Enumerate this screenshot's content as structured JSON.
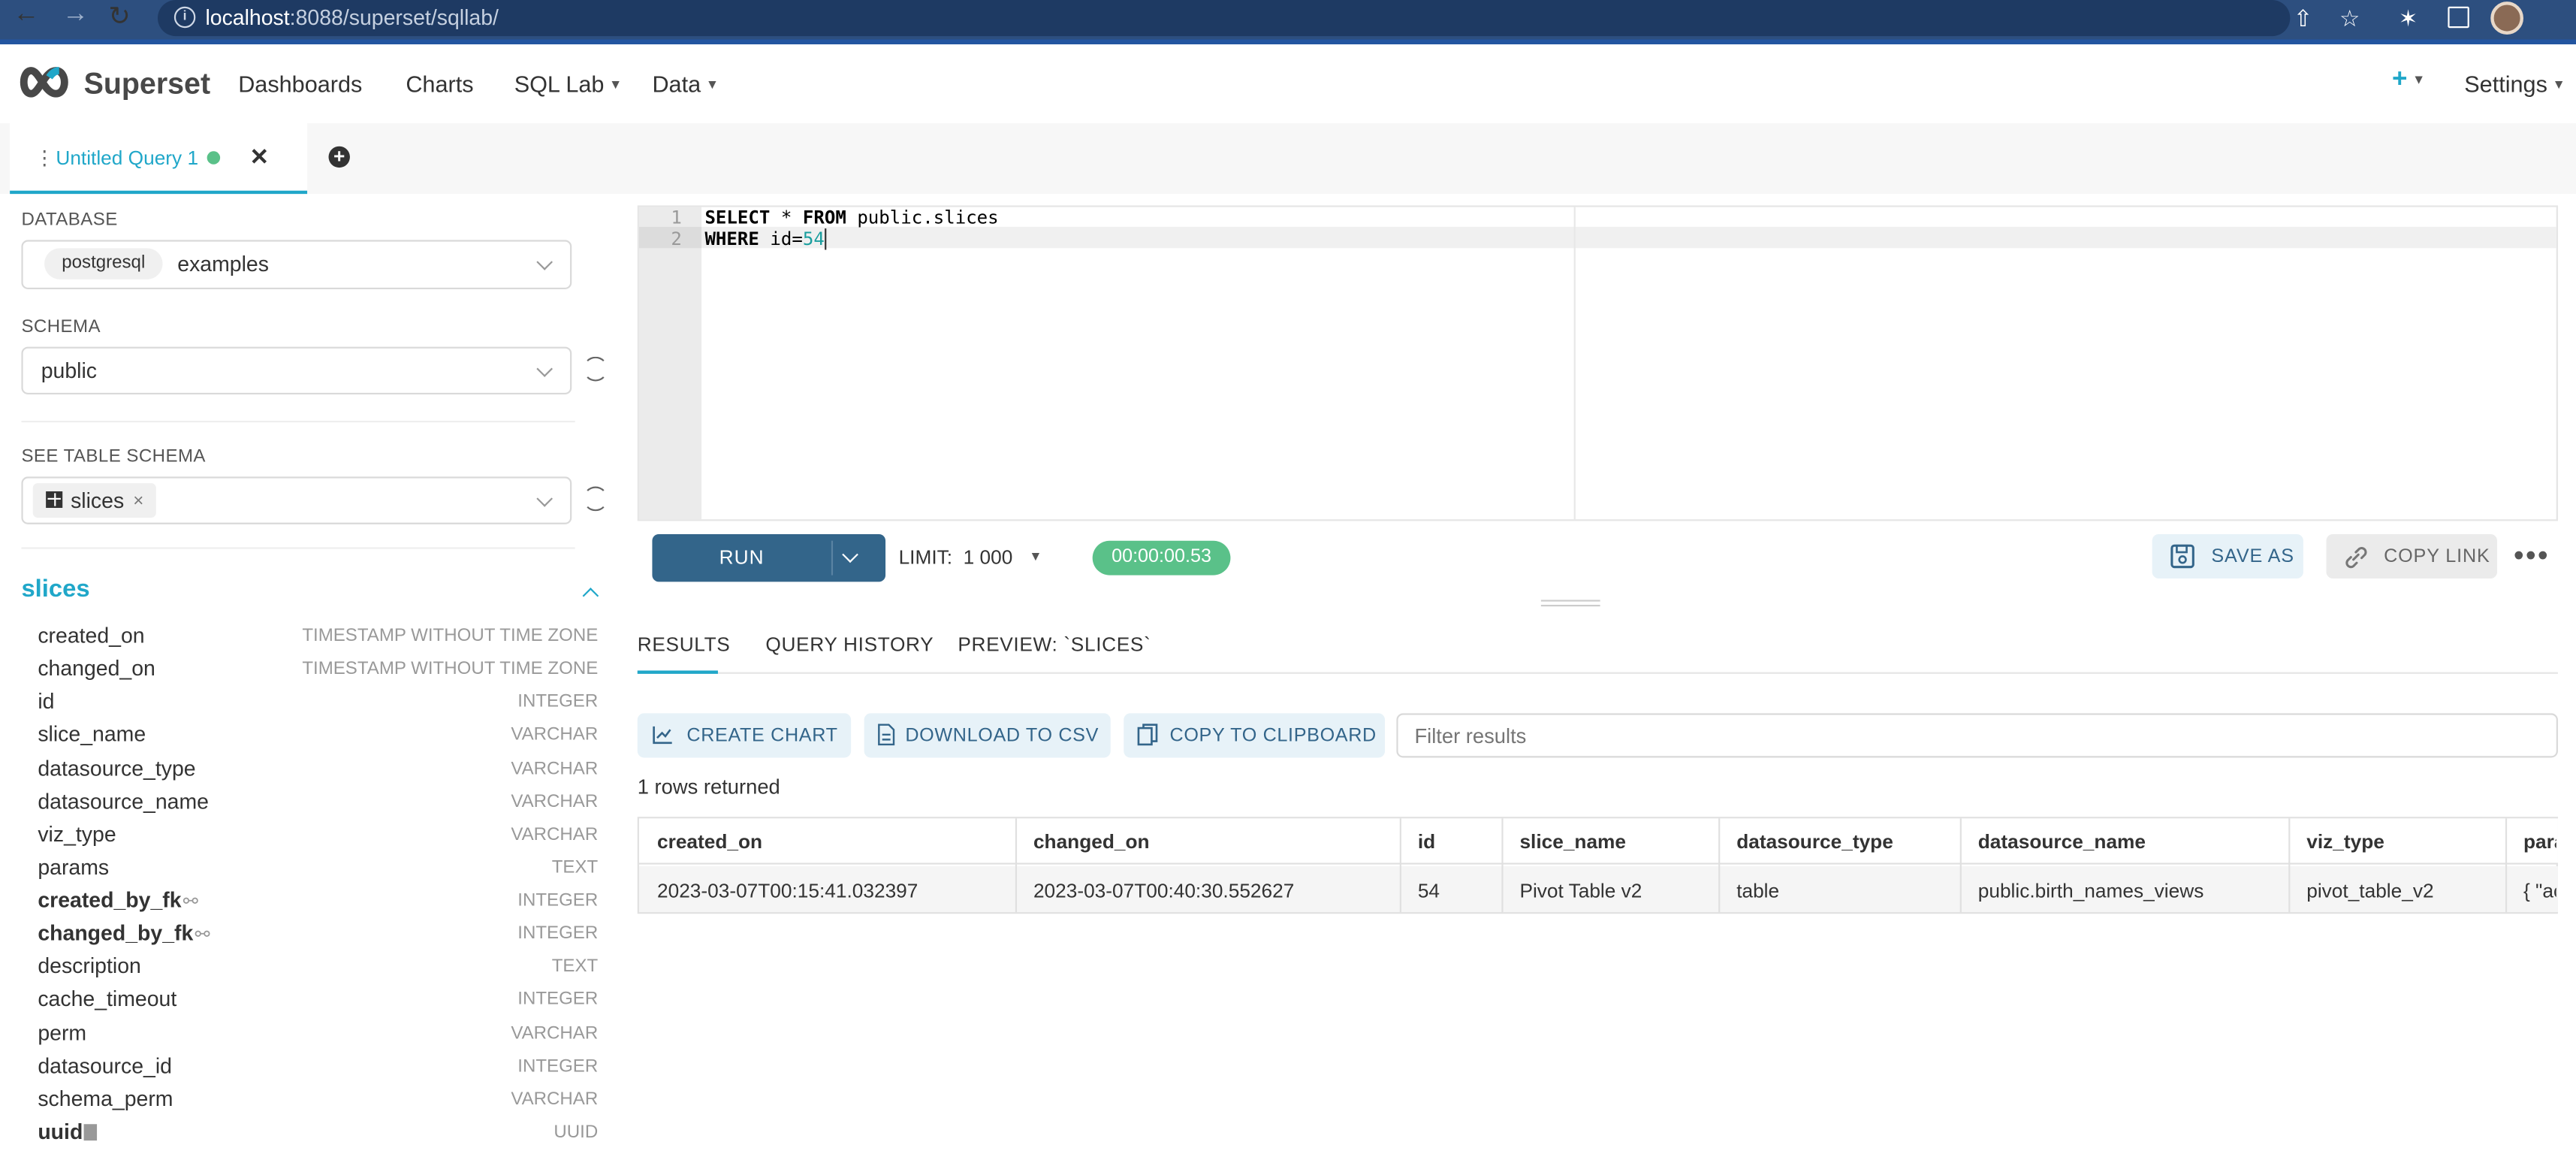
{
  "browser": {
    "url_host": "localhost",
    "url_path": ":8088/superset/sqllab/",
    "back_icon": "arrow-left-icon",
    "forward_icon": "arrow-right-icon",
    "reload_icon": "reload-icon"
  },
  "nav": {
    "brand": "Superset",
    "items": [
      {
        "label": "Dashboards"
      },
      {
        "label": "Charts"
      },
      {
        "label": "SQL Lab"
      },
      {
        "label": "Data"
      }
    ],
    "plus": "+",
    "settings": "Settings"
  },
  "tabs": {
    "active_label": "Untitled Query 1",
    "drag": "⋮",
    "close": "✕",
    "add": "+"
  },
  "sidebar": {
    "database_label": "DATABASE",
    "database_engine": "postgresql",
    "database_name": "examples",
    "schema_label": "SCHEMA",
    "schema_value": "public",
    "table_label": "SEE TABLE SCHEMA",
    "table_value": "slices",
    "table_tag_close": "×",
    "table_title": "slices",
    "columns": [
      {
        "name": "created_on",
        "type": "TIMESTAMP WITHOUT TIME ZONE"
      },
      {
        "name": "changed_on",
        "type": "TIMESTAMP WITHOUT TIME ZONE"
      },
      {
        "name": "id",
        "type": "INTEGER"
      },
      {
        "name": "slice_name",
        "type": "VARCHAR"
      },
      {
        "name": "datasource_type",
        "type": "VARCHAR"
      },
      {
        "name": "datasource_name",
        "type": "VARCHAR"
      },
      {
        "name": "viz_type",
        "type": "VARCHAR"
      },
      {
        "name": "params",
        "type": "TEXT"
      },
      {
        "name": "created_by_fk",
        "type": "INTEGER"
      },
      {
        "name": "changed_by_fk",
        "type": "INTEGER"
      },
      {
        "name": "description",
        "type": "TEXT"
      },
      {
        "name": "cache_timeout",
        "type": "INTEGER"
      },
      {
        "name": "perm",
        "type": "VARCHAR"
      },
      {
        "name": "datasource_id",
        "type": "INTEGER"
      },
      {
        "name": "schema_perm",
        "type": "VARCHAR"
      },
      {
        "name": "uuid",
        "type": "UUID"
      }
    ]
  },
  "editor": {
    "line_numbers": [
      "1",
      "2"
    ],
    "line1": {
      "kw1": "SELECT",
      "mid": " * ",
      "kw2": "FROM",
      "rest": " public.slices"
    },
    "line2": {
      "kw": "WHERE",
      "rest": " id=",
      "num": "54"
    }
  },
  "toolbar": {
    "run_label": "RUN",
    "limit_label": "LIMIT:",
    "limit_value": "1 000",
    "timer": "00:00:00.53",
    "save_as": "SAVE AS",
    "copy_link": "COPY LINK",
    "more": "•••"
  },
  "results": {
    "tabs": [
      "RESULTS",
      "QUERY HISTORY",
      "PREVIEW: `SLICES`"
    ],
    "create_chart": "CREATE CHART",
    "download_csv": "DOWNLOAD TO CSV",
    "copy_clipboard": "COPY TO CLIPBOARD",
    "filter_placeholder": "Filter results",
    "rows_returned": "1 rows returned",
    "columns": [
      "created_on",
      "changed_on",
      "id",
      "slice_name",
      "datasource_type",
      "datasource_name",
      "viz_type",
      "para"
    ],
    "row": [
      "2023-03-07T00:15:41.032397",
      "2023-03-07T00:40:30.552627",
      "54",
      "Pivot Table v2",
      "table",
      "public.birth_names_views",
      "pivot_table_v2",
      "{ \"ac"
    ]
  },
  "colors": {
    "brand_blue": "#20a7c9",
    "run_button": "#33658a",
    "success_green": "#5ac189",
    "browser_bar": "#2d4f7f"
  }
}
